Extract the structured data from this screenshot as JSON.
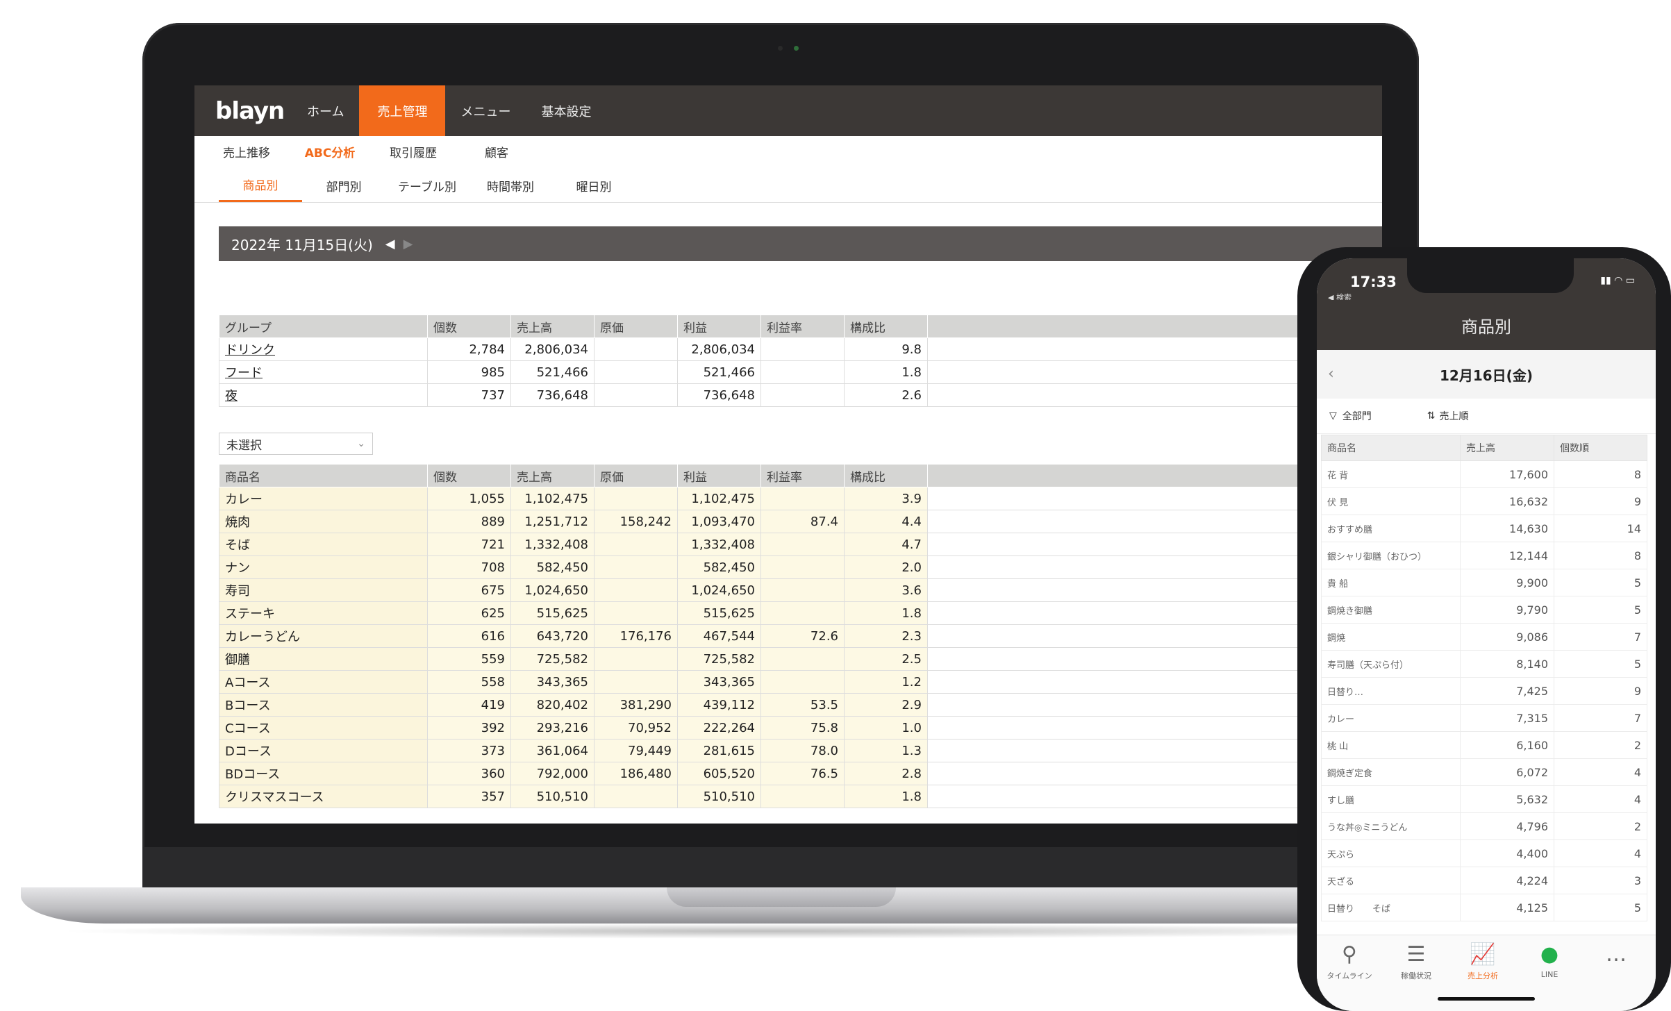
{
  "app": {
    "logo": "blayn",
    "nav": [
      "ホーム",
      "売上管理",
      "メニュー",
      "基本設定"
    ],
    "nav_active_index": 1,
    "subnav": [
      "売上推移",
      "ABC分析",
      "取引履歴",
      "顧客"
    ],
    "subnav_active_index": 1,
    "tabs": [
      "商品別",
      "部門別",
      "テーブル別",
      "時間帯別",
      "曜日別"
    ],
    "tabs_active_index": 0,
    "date": "2022年 11月15日(火)",
    "accent_color": "#f26a1b",
    "header_color": "#3c3836"
  },
  "group_table": {
    "headers": [
      "グループ",
      "個数",
      "売上高",
      "原価",
      "利益",
      "利益率",
      "構成比"
    ],
    "rows": [
      [
        "ドリンク",
        "2,784",
        "2,806,034",
        "",
        "2,806,034",
        "",
        "9.8"
      ],
      [
        "フード",
        "985",
        "521,466",
        "",
        "521,466",
        "",
        "1.8"
      ],
      [
        "夜",
        "737",
        "736,648",
        "",
        "736,648",
        "",
        "2.6"
      ]
    ]
  },
  "select_value": "未選択",
  "item_table": {
    "headers": [
      "商品名",
      "個数",
      "売上高",
      "原価",
      "利益",
      "利益率",
      "構成比"
    ],
    "rows": [
      [
        "カレー",
        "1,055",
        "1,102,475",
        "",
        "1,102,475",
        "",
        "3.9"
      ],
      [
        "焼肉",
        "889",
        "1,251,712",
        "158,242",
        "1,093,470",
        "87.4",
        "4.4"
      ],
      [
        "そば",
        "721",
        "1,332,408",
        "",
        "1,332,408",
        "",
        "4.7"
      ],
      [
        "ナン",
        "708",
        "582,450",
        "",
        "582,450",
        "",
        "2.0"
      ],
      [
        "寿司",
        "675",
        "1,024,650",
        "",
        "1,024,650",
        "",
        "3.6"
      ],
      [
        "ステーキ",
        "625",
        "515,625",
        "",
        "515,625",
        "",
        "1.8"
      ],
      [
        "カレーうどん",
        "616",
        "643,720",
        "176,176",
        "467,544",
        "72.6",
        "2.3"
      ],
      [
        "御膳",
        "559",
        "725,582",
        "",
        "725,582",
        "",
        "2.5"
      ],
      [
        "Aコース",
        "558",
        "343,365",
        "",
        "343,365",
        "",
        "1.2"
      ],
      [
        "Bコース",
        "419",
        "820,402",
        "381,290",
        "439,112",
        "53.5",
        "2.9"
      ],
      [
        "Cコース",
        "392",
        "293,216",
        "70,952",
        "222,264",
        "75.8",
        "1.0"
      ],
      [
        "Dコース",
        "373",
        "361,064",
        "79,449",
        "281,615",
        "78.0",
        "1.3"
      ],
      [
        "BDコース",
        "360",
        "792,000",
        "186,480",
        "605,520",
        "76.5",
        "2.8"
      ],
      [
        "クリスマスコース",
        "357",
        "510,510",
        "",
        "510,510",
        "",
        "1.8"
      ]
    ]
  },
  "phone": {
    "time": "17:33",
    "back_label": "◀ 検索",
    "title": "商品別",
    "date": "12月16日(金)",
    "filter_dept": "全部門",
    "filter_sort": "売上順",
    "headers": [
      "商品名",
      "売上高",
      "個数順"
    ],
    "rows": [
      [
        "花 背",
        "17,600",
        "8"
      ],
      [
        "伏 見",
        "16,632",
        "9"
      ],
      [
        "おすすめ膳",
        "14,630",
        "14"
      ],
      [
        "銀シャリ御膳（おひつ）",
        "12,144",
        "8"
      ],
      [
        "貴 船",
        "9,900",
        "5"
      ],
      [
        "鋼焼き御膳",
        "9,790",
        "5"
      ],
      [
        "鋼焼",
        "9,086",
        "7"
      ],
      [
        "寿司膳（天ぷら付）",
        "8,140",
        "5"
      ],
      [
        "日替り…",
        "7,425",
        "9"
      ],
      [
        "カレー",
        "7,315",
        "7"
      ],
      [
        "桃 山",
        "6,160",
        "2"
      ],
      [
        "鋼焼ぎ定食",
        "6,072",
        "4"
      ],
      [
        "すし膳",
        "5,632",
        "4"
      ],
      [
        "うな丼◎ミニうどん",
        "4,796",
        "2"
      ],
      [
        "天ぷら",
        "4,400",
        "4"
      ],
      [
        "天ざる",
        "4,224",
        "3"
      ],
      [
        "日替り　　そば",
        "4,125",
        "5"
      ]
    ],
    "tabbar": [
      "タイムライン",
      "稼働状況",
      "売上分析",
      "LINE",
      "…"
    ],
    "tabbar_active_index": 2
  }
}
